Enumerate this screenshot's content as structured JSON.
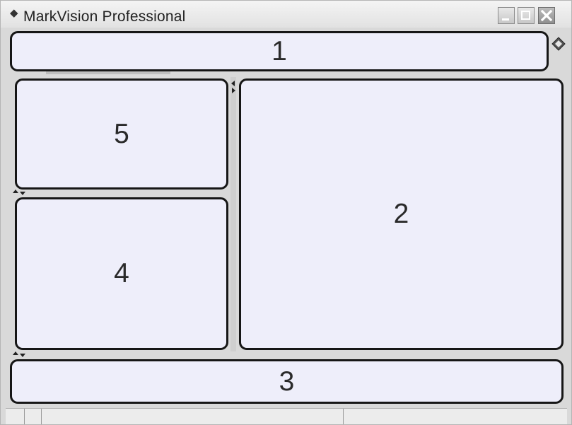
{
  "window": {
    "title": "MarkVision Professional",
    "title_glyph": "◆",
    "icons": [
      "diamond-icon",
      "minimize-icon",
      "maximize-icon",
      "close-icon"
    ]
  },
  "panels": {
    "p1": "1",
    "p2": "2",
    "p3": "3",
    "p4": "4",
    "p5": "5"
  },
  "colors": {
    "panel_fill": "#eeeefa",
    "panel_border": "#161616",
    "window_bg": "#d9d9d9"
  }
}
